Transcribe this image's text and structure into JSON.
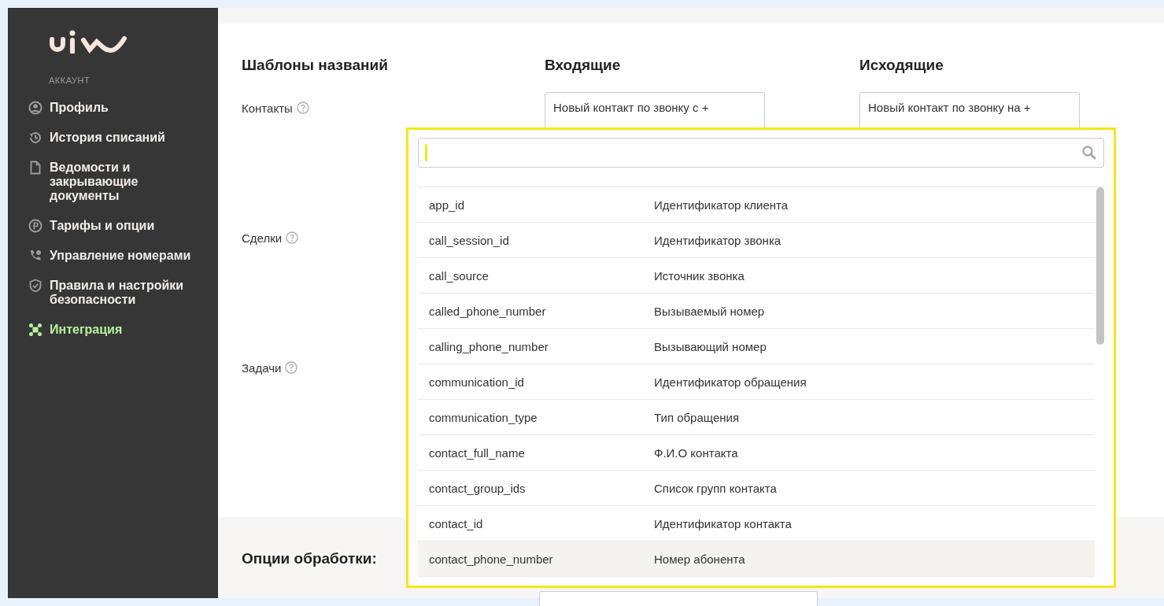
{
  "sidebar": {
    "section": "АККАУНТ",
    "items": [
      {
        "label": "Профиль",
        "selected": false
      },
      {
        "label": "История списаний",
        "selected": false
      },
      {
        "label": "Ведомости и закрывающие документы",
        "selected": false
      },
      {
        "label": "Тарифы и опции",
        "selected": false
      },
      {
        "label": "Управление номерами",
        "selected": false
      },
      {
        "label": "Правила и настройки безопасности",
        "selected": false
      },
      {
        "label": "Интеграция",
        "selected": true
      }
    ]
  },
  "templates": {
    "title": "Шаблоны названий",
    "columns": [
      "Входящие",
      "Исходящие"
    ],
    "rows": [
      {
        "label": "Контакты",
        "values": [
          "Новый контакт по звонку с +",
          "Новый контакт по звонку на +"
        ]
      },
      {
        "label": "Сделки",
        "values": []
      },
      {
        "label": "Задачи",
        "values": []
      }
    ]
  },
  "processing": {
    "title": "Опции обработки:"
  },
  "dropdown": {
    "items": [
      {
        "key": "app_id",
        "description": "Идентификатор клиента",
        "selected": false
      },
      {
        "key": "call_session_id",
        "description": "Идентификатор звонка",
        "selected": false
      },
      {
        "key": "call_source",
        "description": "Источник звонка",
        "selected": false
      },
      {
        "key": "called_phone_number",
        "description": "Вызываемый номер",
        "selected": false
      },
      {
        "key": "calling_phone_number",
        "description": "Вызывающий номер",
        "selected": false
      },
      {
        "key": "communication_id",
        "description": "Идентификатор обращения",
        "selected": false
      },
      {
        "key": "communication_type",
        "description": "Тип обращения",
        "selected": false
      },
      {
        "key": "contact_full_name",
        "description": "Ф.И.О контакта",
        "selected": false
      },
      {
        "key": "contact_group_ids",
        "description": "Список групп контакта",
        "selected": false
      },
      {
        "key": "contact_id",
        "description": "Идентификатор контакта",
        "selected": false
      },
      {
        "key": "contact_phone_number",
        "description": "Номер абонента",
        "selected": true
      }
    ]
  }
}
